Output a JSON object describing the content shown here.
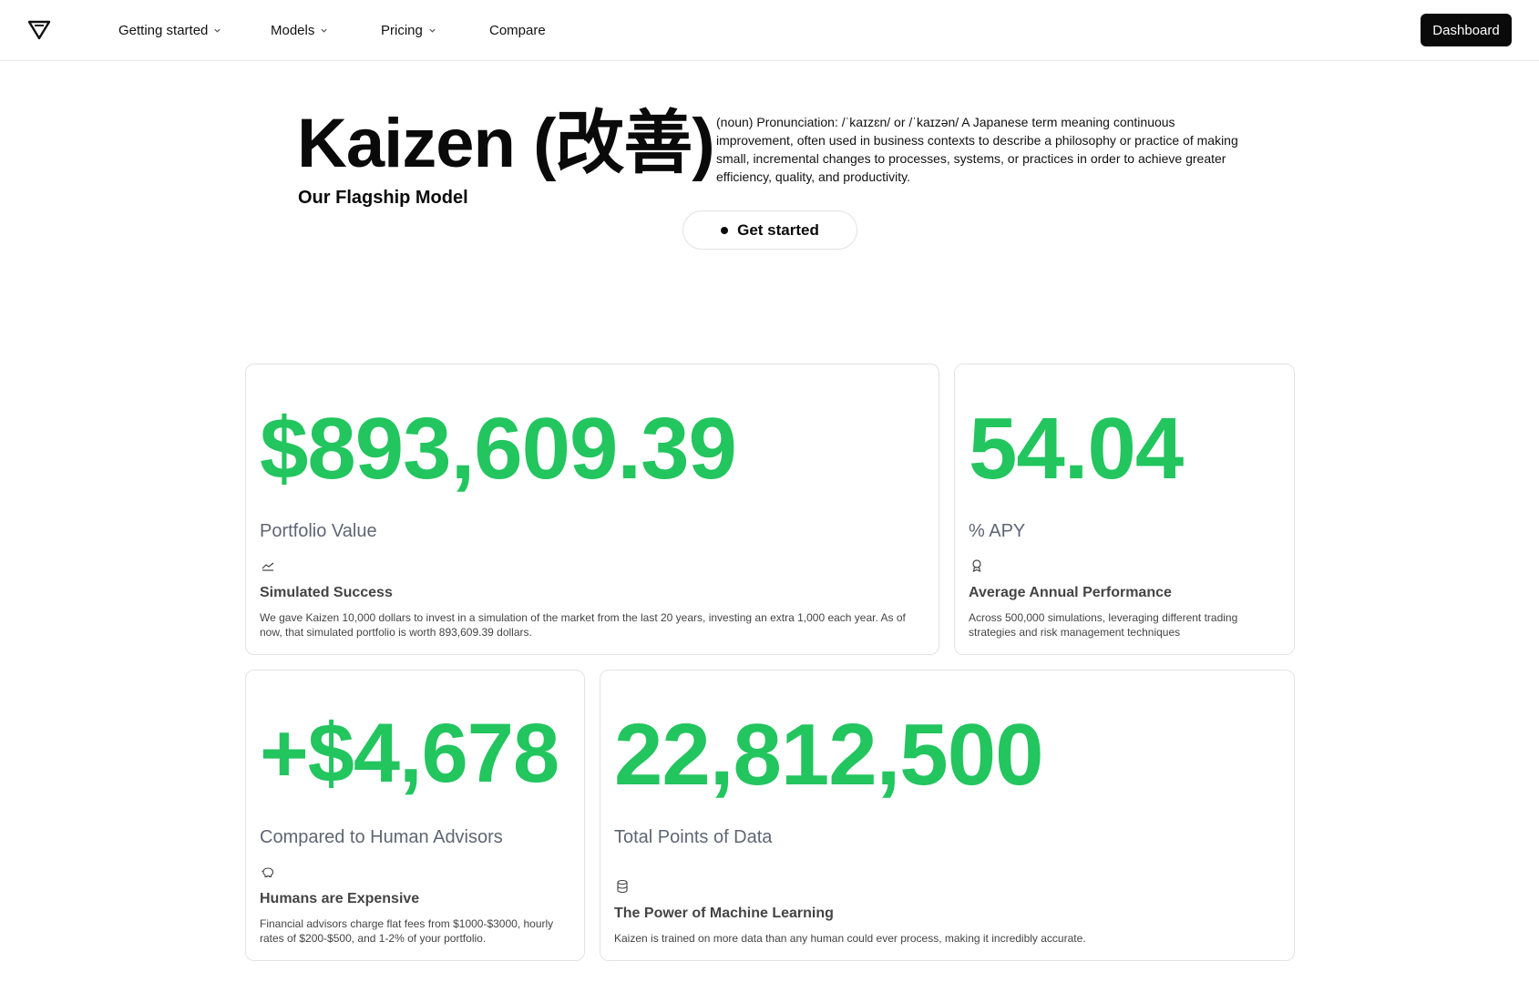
{
  "nav": {
    "items": [
      {
        "label": "Getting started",
        "has_dropdown": true
      },
      {
        "label": "Models",
        "has_dropdown": true
      },
      {
        "label": "Pricing",
        "has_dropdown": true
      },
      {
        "label": "Compare",
        "has_dropdown": false
      }
    ],
    "dashboard_label": "Dashboard"
  },
  "hero": {
    "title": "Kaizen (改善)",
    "subtitle": "Our Flagship Model",
    "definition": "(noun) Pronunciation: /ˈkaɪzɛn/ or /ˈkaɪzən/ A Japanese term meaning continuous improvement, often used in business contexts to describe a philosophy or practice of making small, incremental changes to processes, systems, or practices in order to achieve greater efficiency, quality, and productivity.",
    "cta_label": "Get started"
  },
  "cards": [
    {
      "value": "$893,609.39",
      "label": "Portfolio Value",
      "icon": "chart-line-icon",
      "heading": "Simulated Success",
      "description": "We gave Kaizen 10,000 dollars to invest in a simulation of the market from the last 20 years, investing an extra 1,000 each year. As of now, that simulated portfolio is worth 893,609.39 dollars."
    },
    {
      "value": "54.04",
      "label": "% APY",
      "icon": "award-icon",
      "heading": "Average Annual Performance",
      "description": "Across 500,000 simulations, leveraging different trading strategies and risk management techniques"
    },
    {
      "value": "+$4,678",
      "label": "Compared to Human Advisors",
      "icon": "piggy-bank-icon",
      "heading": "Humans are Expensive",
      "description": "Financial advisors charge flat fees from $1000-$3000, hourly rates of $200-$500, and 1-2% of your portfolio."
    },
    {
      "value": "22,812,500",
      "label": "Total Points of Data",
      "icon": "database-icon",
      "heading": "The Power of Machine Learning",
      "description": "Kaizen is trained on more data than any human could ever process, making it incredibly accurate."
    }
  ],
  "colors": {
    "accent_green": "#22c55e",
    "button_dark": "#0a0a0a",
    "muted_text": "#5f6673"
  }
}
